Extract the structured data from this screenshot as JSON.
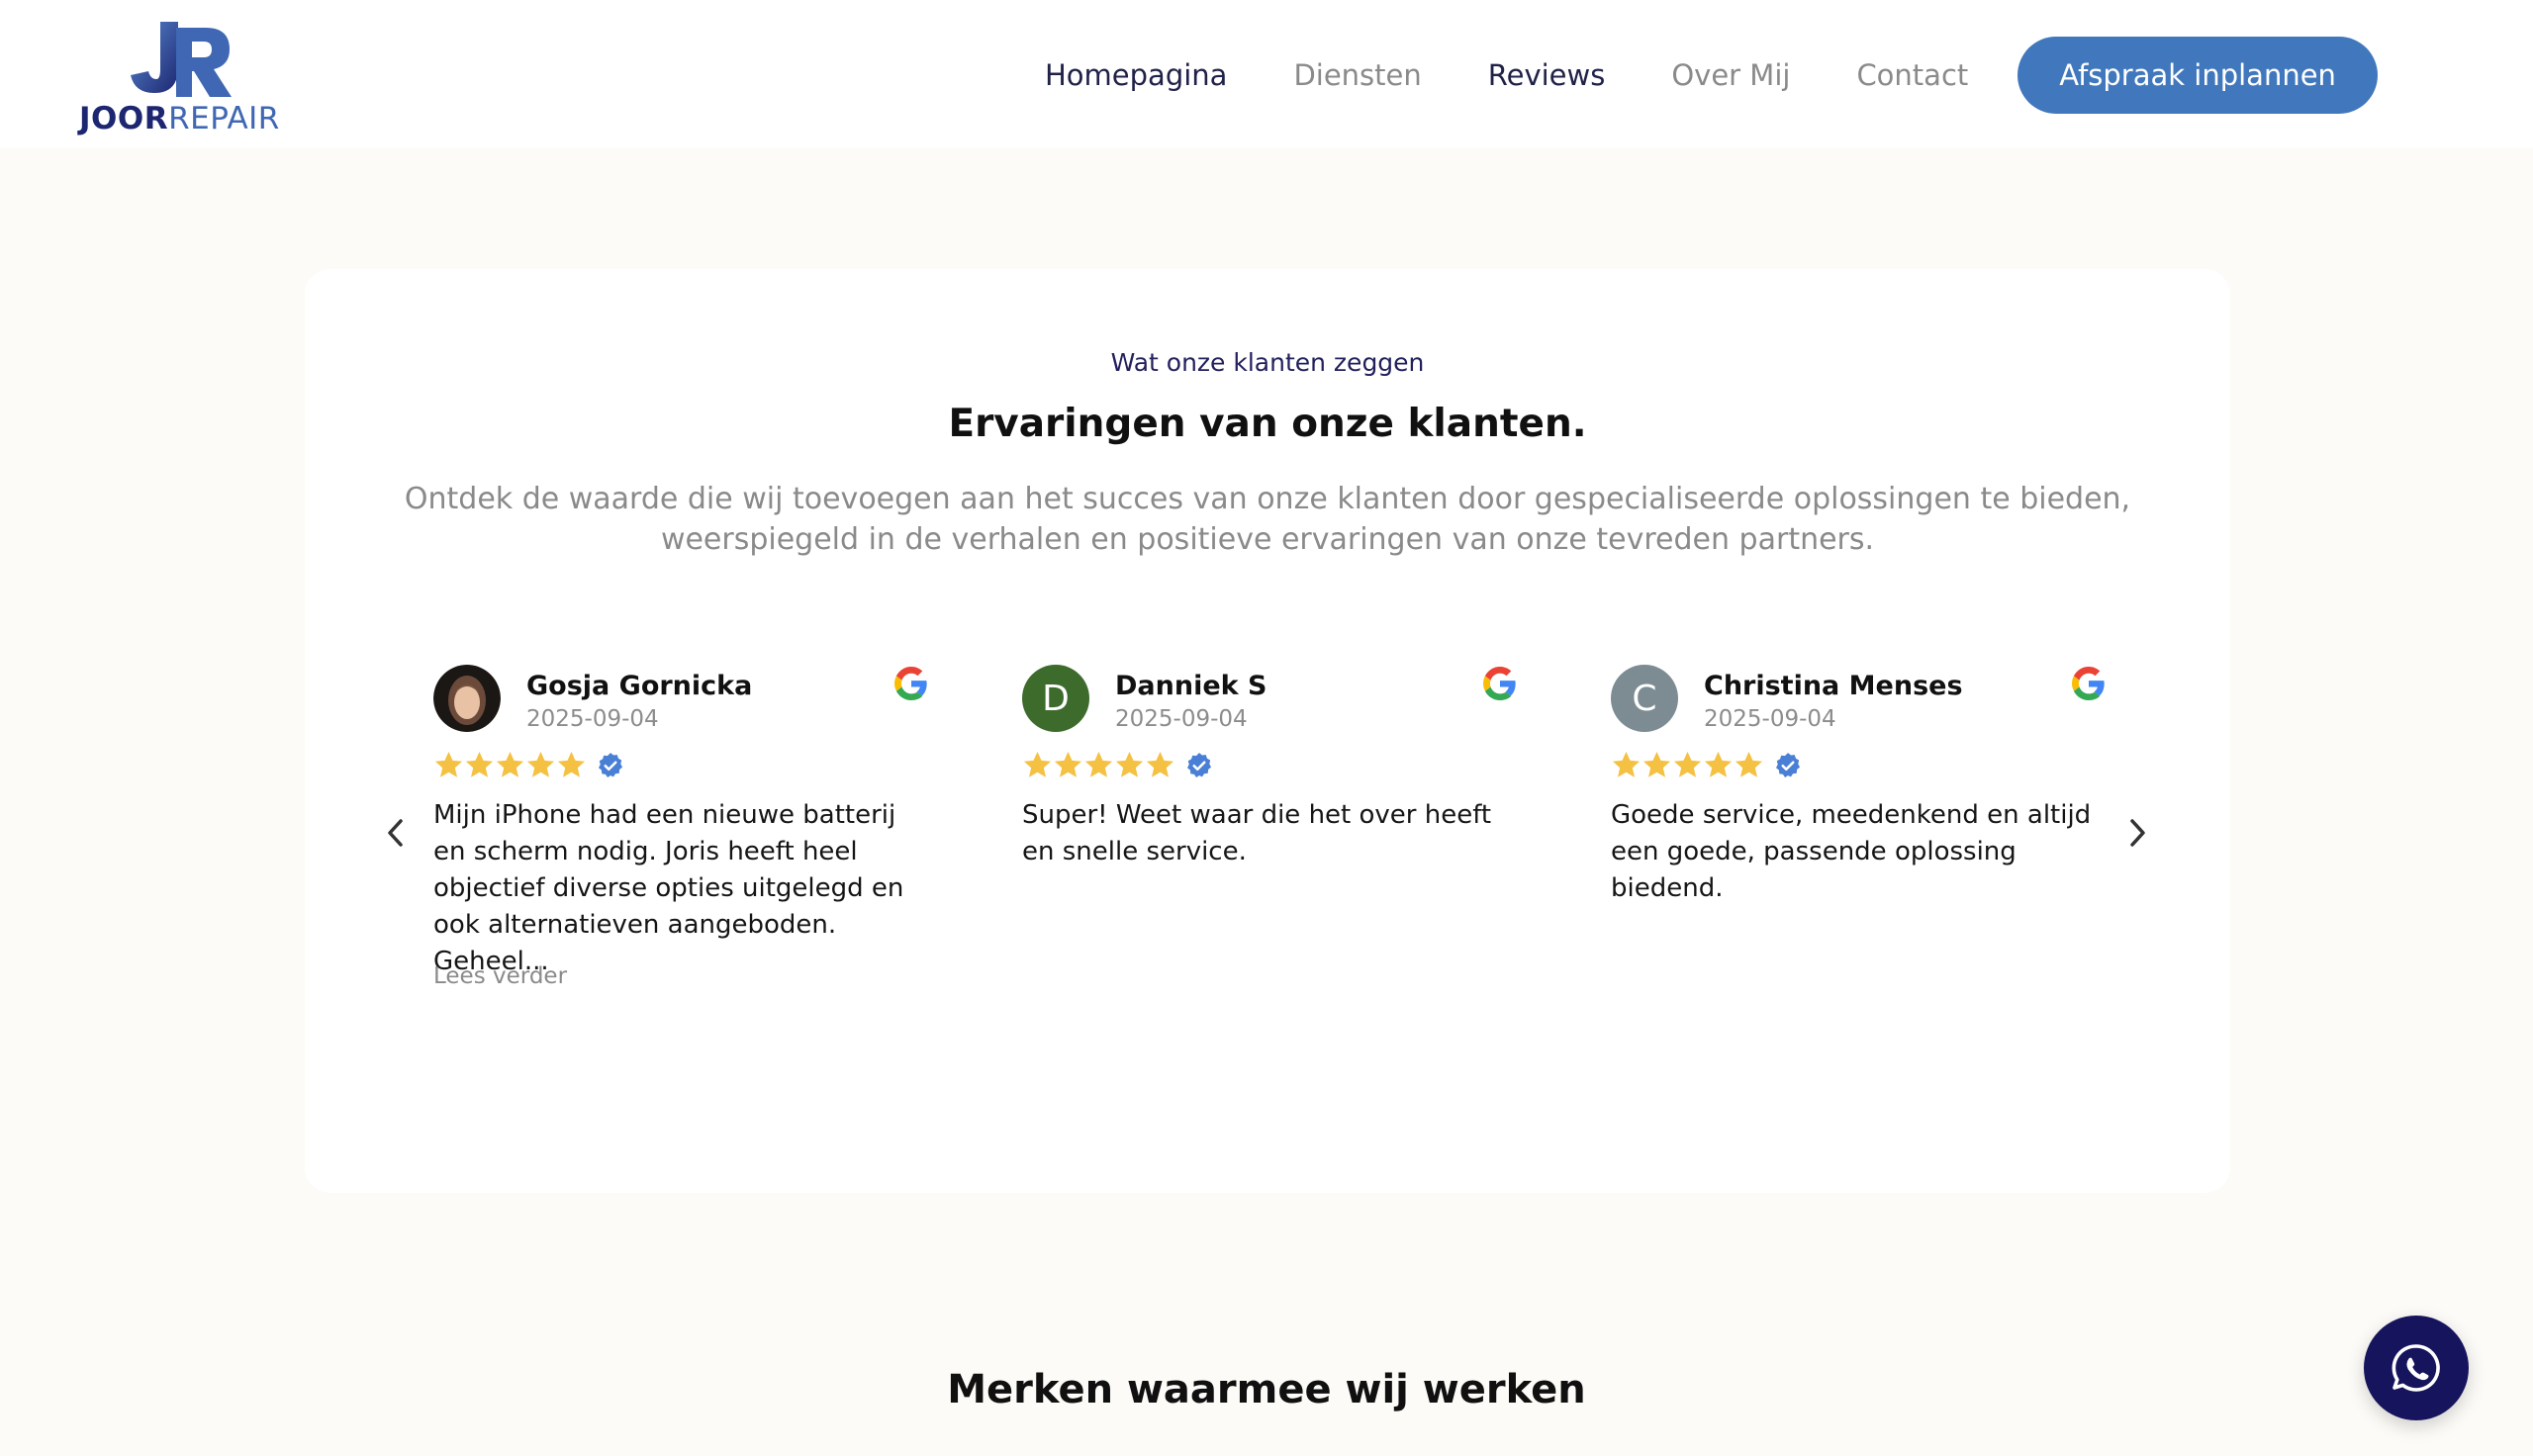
{
  "brand": {
    "logo_word_1": "JOOR",
    "logo_word_2": "REPAIR",
    "primary_color": "#1d2670",
    "accent_color": "#4178bd"
  },
  "nav": {
    "items": [
      {
        "label": "Homepagina"
      },
      {
        "label": "Diensten"
      },
      {
        "label": "Reviews"
      },
      {
        "label": "Over Mij"
      },
      {
        "label": "Contact"
      }
    ],
    "cta_label": "Afspraak inplannen"
  },
  "reviews_section": {
    "eyebrow": "Wat onze klanten zeggen",
    "title": "Ervaringen van onze klanten.",
    "subtitle": "Ontdek de waarde die wij toevoegen aan het succes van onze klanten door gespecialiseerde oplossingen te bieden, weerspiegeld in de verhalen en positieve ervaringen van onze tevreden partners.",
    "prev_icon": "chevron-left-icon",
    "next_icon": "chevron-right-icon",
    "reviews": [
      {
        "name": "Gosja Gornicka",
        "date": "2025-09-04",
        "rating": 5,
        "avatar_initial": "",
        "avatar_color": "#6b4a3a",
        "text": "Mijn iPhone had een nieuwe batterij en scherm nodig. Joris heeft heel objectief diverse opties uitgelegd en ook alternatieven aangeboden. Geheel...",
        "read_more": "Lees verder",
        "source_icon": "google-icon"
      },
      {
        "name": "Danniek S",
        "date": "2025-09-04",
        "rating": 5,
        "avatar_initial": "D",
        "avatar_color": "#3d6b2c",
        "text": "Super! Weet waar die het over heeft en snelle service.",
        "source_icon": "google-icon"
      },
      {
        "name": "Christina Menses",
        "date": "2025-09-04",
        "rating": 5,
        "avatar_initial": "C",
        "avatar_color": "#7d8b93",
        "text": "Goede service, meedenkend en altijd een goede, passende oplossing biedend.",
        "source_icon": "google-icon"
      }
    ]
  },
  "brands_section": {
    "title": "Merken waarmee wij werken"
  },
  "whatsapp": {
    "icon": "whatsapp-icon",
    "color": "#16145c"
  },
  "star_color": "#f4c142",
  "verified_color": "#4a7fd6"
}
